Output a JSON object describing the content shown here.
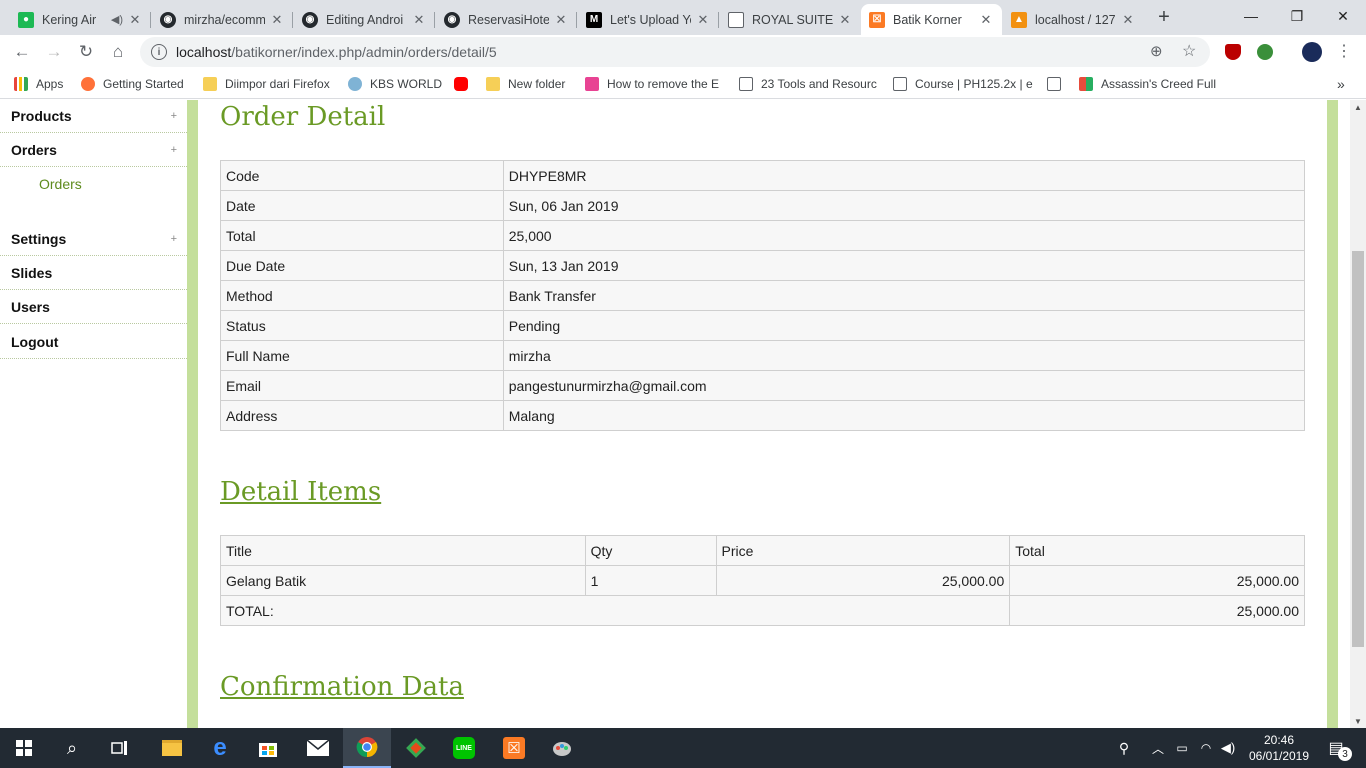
{
  "tabs": [
    {
      "title": "Kering Air",
      "icon": "music-player-icon",
      "color": "#1db954",
      "extra": "mute-icon"
    },
    {
      "title": "mirzha/ecomm",
      "icon": "github-icon",
      "color": "#24292e"
    },
    {
      "title": "Editing Androi",
      "icon": "github-icon",
      "color": "#24292e"
    },
    {
      "title": "ReservasiHotel",
      "icon": "github-icon",
      "color": "#24292e"
    },
    {
      "title": "Let's Upload Yo",
      "icon": "medium-icon",
      "color": "#000000"
    },
    {
      "title": "ROYAL SUITE",
      "icon": "document-icon",
      "color": "#ffffff"
    },
    {
      "title": "Batik Korner",
      "icon": "xampp-icon",
      "color": "#fb7a24"
    },
    {
      "title": "localhost / 127",
      "icon": "phpmyadmin-icon",
      "color": "#f29111"
    }
  ],
  "url": {
    "host": "localhost",
    "path": "/batikorner/index.php/admin/orders/detail/5"
  },
  "bookmarks": [
    {
      "label": "Apps",
      "icon": "apps-grid-icon"
    },
    {
      "label": "Getting Started",
      "icon": "firefox-icon"
    },
    {
      "label": "Diimpor dari Firefox",
      "icon": "folder-icon"
    },
    {
      "label": "KBS WORLD",
      "icon": "kbs-icon"
    },
    {
      "label": "",
      "icon": "youtube-icon"
    },
    {
      "label": "New folder",
      "icon": "folder-icon"
    },
    {
      "label": "How to remove the E",
      "icon": "bookmark-site-icon"
    },
    {
      "label": "23 Tools and Resourc",
      "icon": "page-icon"
    },
    {
      "label": "Course | PH125.2x | e",
      "icon": "page-icon"
    },
    {
      "label": "",
      "icon": "page-icon"
    },
    {
      "label": "Assassin's Creed Full",
      "icon": "windows-flag-icon"
    }
  ],
  "sidebar": {
    "products": "Products",
    "orders": "Orders",
    "orders_sub": "Orders",
    "settings": "Settings",
    "slides": "Slides",
    "users": "Users",
    "logout": "Logout",
    "plus": "+"
  },
  "order_detail": {
    "heading": "Order Detail",
    "rows": [
      {
        "label": "Code",
        "value": "DHYPE8MR"
      },
      {
        "label": "Date",
        "value": "Sun, 06 Jan 2019"
      },
      {
        "label": "Total",
        "value": "25,000"
      },
      {
        "label": "Due Date",
        "value": "Sun, 13 Jan 2019"
      },
      {
        "label": "Method",
        "value": "Bank Transfer"
      },
      {
        "label": "Status",
        "value": "Pending"
      },
      {
        "label": "Full Name",
        "value": "mirzha"
      },
      {
        "label": "Email",
        "value": "pangestunurmirzha@gmail.com"
      },
      {
        "label": "Address",
        "value": "Malang"
      }
    ]
  },
  "detail_items": {
    "heading": "Detail Items",
    "headers": [
      "Title",
      "Qty",
      "Price",
      "Total"
    ],
    "items": [
      {
        "title": "Gelang Batik",
        "qty": "1",
        "price": "25,000.00",
        "total": "25,000.00"
      }
    ],
    "total_label": "TOTAL:",
    "total_value": "25,000.00"
  },
  "confirmation": {
    "heading": "Confirmation Data"
  },
  "taskbar": {
    "time": "20:46",
    "date": "06/01/2019",
    "notifications": "3"
  },
  "colors": {
    "accent_green": "#6a9a25",
    "side_bar": "#c4df9b",
    "taskbar": "#222a33"
  }
}
